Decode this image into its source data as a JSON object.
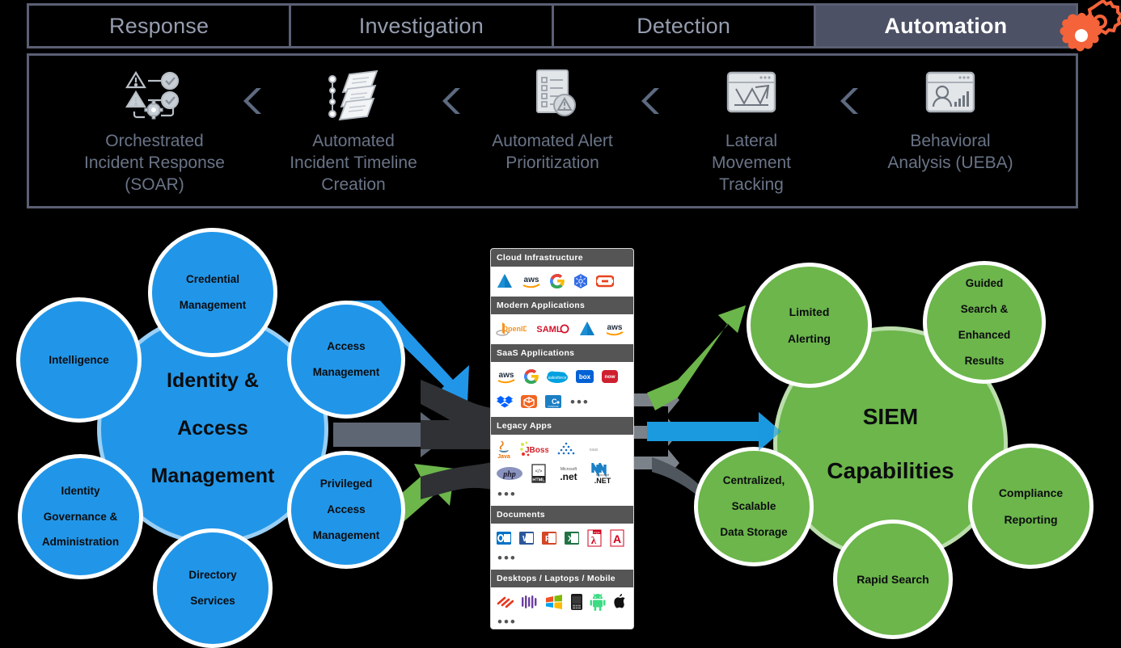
{
  "tabs": [
    {
      "label": "Response",
      "active": false
    },
    {
      "label": "Investigation",
      "active": false
    },
    {
      "label": "Detection",
      "active": false
    },
    {
      "label": "Automation",
      "active": true
    }
  ],
  "automation_steps": [
    {
      "label": "Orchestrated\nIncident Response\n(SOAR)",
      "line1": "Orchestrated",
      "line2": "Incident Response",
      "line3": "(SOAR)",
      "icon": "alert-workflow-gear-icon"
    },
    {
      "label": "Automated\nIncident Timeline\nCreation",
      "line1": "Automated",
      "line2": "Incident Timeline",
      "line3": "Creation",
      "icon": "timeline-documents-icon"
    },
    {
      "label": "Automated Alert\nPrioritization",
      "line1": "Automated Alert",
      "line2": "Prioritization",
      "line3": "",
      "icon": "checklist-warning-icon"
    },
    {
      "label": "Lateral\nMovement\nTracking",
      "line1": "Lateral",
      "line2": "Movement",
      "line3": "Tracking",
      "icon": "chart-arrows-window-icon"
    },
    {
      "label": "Behavioral\nAnalysis (UEBA)",
      "line1": "Behavioral",
      "line2": "Analysis (UEBA)",
      "line3": "",
      "icon": "user-analytics-window-icon"
    }
  ],
  "left_cluster": {
    "core": {
      "line1": "Identity &",
      "line2": "Access",
      "line3": "Management"
    },
    "satellites": [
      {
        "id": "credential-management",
        "line1": "Credential",
        "line2": "Management",
        "line3": ""
      },
      {
        "id": "intelligence",
        "line1": "Intelligence",
        "line2": "",
        "line3": ""
      },
      {
        "id": "access-management",
        "line1": "Access",
        "line2": "Management",
        "line3": ""
      },
      {
        "id": "identity-governance-administration",
        "line1": "Identity",
        "line2": "Governance &",
        "line3": "Administration"
      },
      {
        "id": "privileged-access-management",
        "line1": "Privileged",
        "line2": "Access",
        "line3": "Management"
      },
      {
        "id": "directory-services",
        "line1": "Directory",
        "line2": "Services",
        "line3": ""
      }
    ]
  },
  "right_cluster": {
    "core": {
      "line1": "SIEM",
      "line2": "Capabilities",
      "line3": ""
    },
    "satellites": [
      {
        "id": "limited-alerting",
        "line1": "Limited",
        "line2": "Alerting",
        "line3": "",
        "line4": ""
      },
      {
        "id": "guided-search-enhanced-results",
        "line1": "Guided",
        "line2": "Search &",
        "line3": "Enhanced",
        "line4": "Results"
      },
      {
        "id": "centralized-scalable-data-storage",
        "line1": "Centralized,",
        "line2": "Scalable",
        "line3": "Data Storage",
        "line4": ""
      },
      {
        "id": "compliance-reporting",
        "line1": "Compliance",
        "line2": "Reporting",
        "line3": "",
        "line4": ""
      },
      {
        "id": "rapid-search",
        "line1": "Rapid Search",
        "line2": "",
        "line3": "",
        "line4": ""
      }
    ]
  },
  "center_panel": {
    "categories": [
      {
        "title": "Cloud Infrastructure",
        "logos": [
          "azure",
          "aws",
          "google",
          "kubernetes",
          "openshift"
        ],
        "ellipsis": false
      },
      {
        "title": "Modern Applications",
        "logos": [
          "openid",
          "saml",
          "azure",
          "aws"
        ],
        "ellipsis": false
      },
      {
        "title": "SaaS Applications",
        "logos": [
          "aws",
          "google",
          "salesforce",
          "box",
          "servicenow",
          "dropbox",
          "workday",
          "concur"
        ],
        "ellipsis": true
      },
      {
        "title": "Legacy Apps",
        "logos": [
          "java",
          "jboss",
          "pyramid",
          "oaas",
          "php",
          "html",
          "dotnet-ms",
          "dotnet"
        ],
        "ellipsis": true
      },
      {
        "title": "Documents",
        "logos": [
          "outlook",
          "word",
          "powerpoint",
          "excel",
          "pdf",
          "acrobat"
        ],
        "ellipsis": true
      },
      {
        "title": "Desktops / Laptops / Mobile",
        "logos": [
          "redhat",
          "suse",
          "windows",
          "blackberry",
          "android",
          "apple"
        ],
        "ellipsis": true
      }
    ]
  },
  "colors": {
    "blue": "#2196e8",
    "green": "#6cb64b",
    "gray_arrow": "#5f6673",
    "dark_arrow": "#2e2e2e",
    "tab_active_bg": "#4c5165",
    "tab_border": "#5a5f74",
    "tab_text": "#959daf",
    "gear_orange": "#f4633a",
    "strip_label": "#6a7487",
    "cat_header_bg": "#555555"
  }
}
